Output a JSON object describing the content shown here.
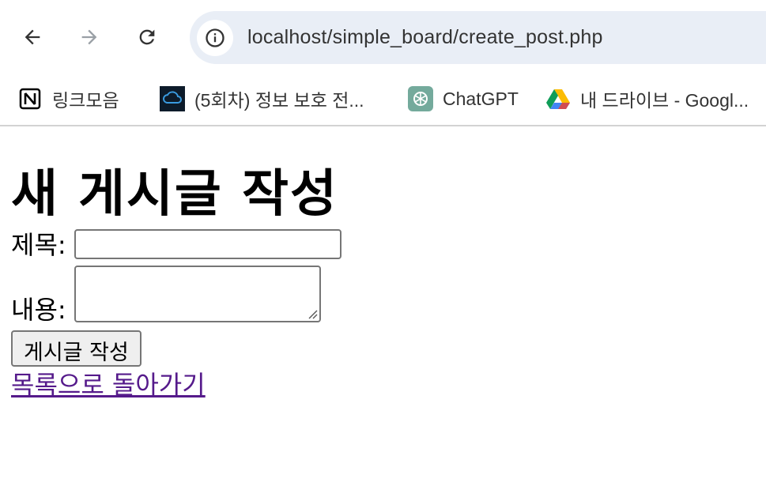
{
  "browser": {
    "url": "localhost/simple_board/create_post.php",
    "bookmarks": [
      {
        "label": "링크모음",
        "icon": "notion-icon"
      },
      {
        "label": "(5회차) 정보 보호 전...",
        "icon": "cloud-icon"
      },
      {
        "label": "ChatGPT",
        "icon": "chatgpt-icon"
      },
      {
        "label": "내 드라이브 - Googl...",
        "icon": "google-drive-icon"
      }
    ]
  },
  "page": {
    "heading": "새 게시글 작성",
    "title_label": "제목:",
    "title_value": "",
    "content_label": "내용:",
    "content_value": "",
    "submit_label": "게시글 작성",
    "back_link": "목록으로 돌아가기"
  },
  "colors": {
    "visited_link": "#551a8b",
    "omnibox_bg": "#e9eef6"
  }
}
